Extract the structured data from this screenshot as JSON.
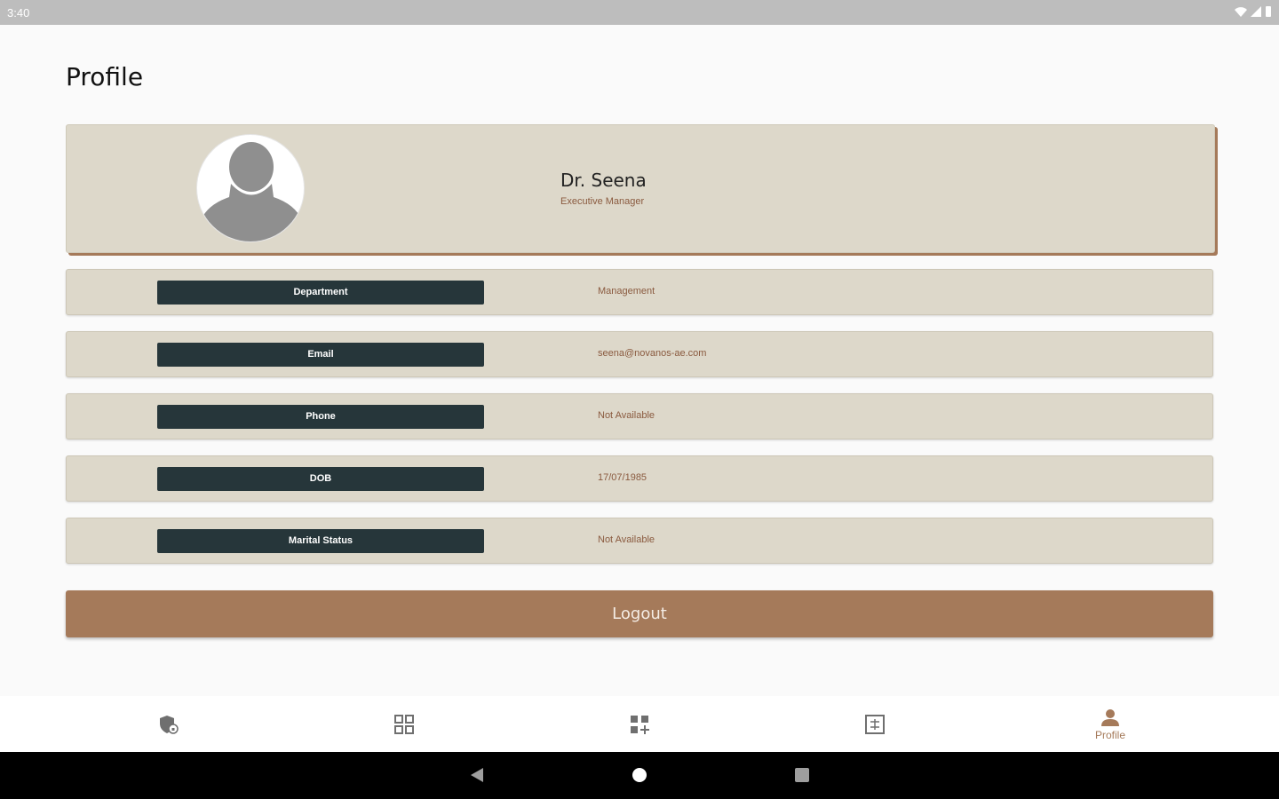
{
  "status_bar": {
    "time": "3:40"
  },
  "page": {
    "title": "Profile"
  },
  "profile": {
    "name": "Dr. Seena",
    "role": "Executive Manager"
  },
  "info_rows": [
    {
      "label": "Department",
      "value": "Management"
    },
    {
      "label": "Email",
      "value": "seena@novanos-ae.com"
    },
    {
      "label": "Phone",
      "value": "Not Available"
    },
    {
      "label": "DOB",
      "value": "17/07/1985"
    },
    {
      "label": "Marital Status",
      "value": "Not Available"
    }
  ],
  "logout": {
    "label": "Logout"
  },
  "bottom_nav": {
    "items": [
      {
        "icon": "shield-lock-icon",
        "label": ""
      },
      {
        "icon": "qr-code-icon",
        "label": ""
      },
      {
        "icon": "grid-add-icon",
        "label": ""
      },
      {
        "icon": "table-icon",
        "label": ""
      },
      {
        "icon": "person-icon",
        "label": "Profile"
      }
    ]
  },
  "colors": {
    "accent": "#a57a5a",
    "card": "#ddd8ca",
    "label_bg": "#26363a",
    "value_text": "#8a5a3f"
  }
}
